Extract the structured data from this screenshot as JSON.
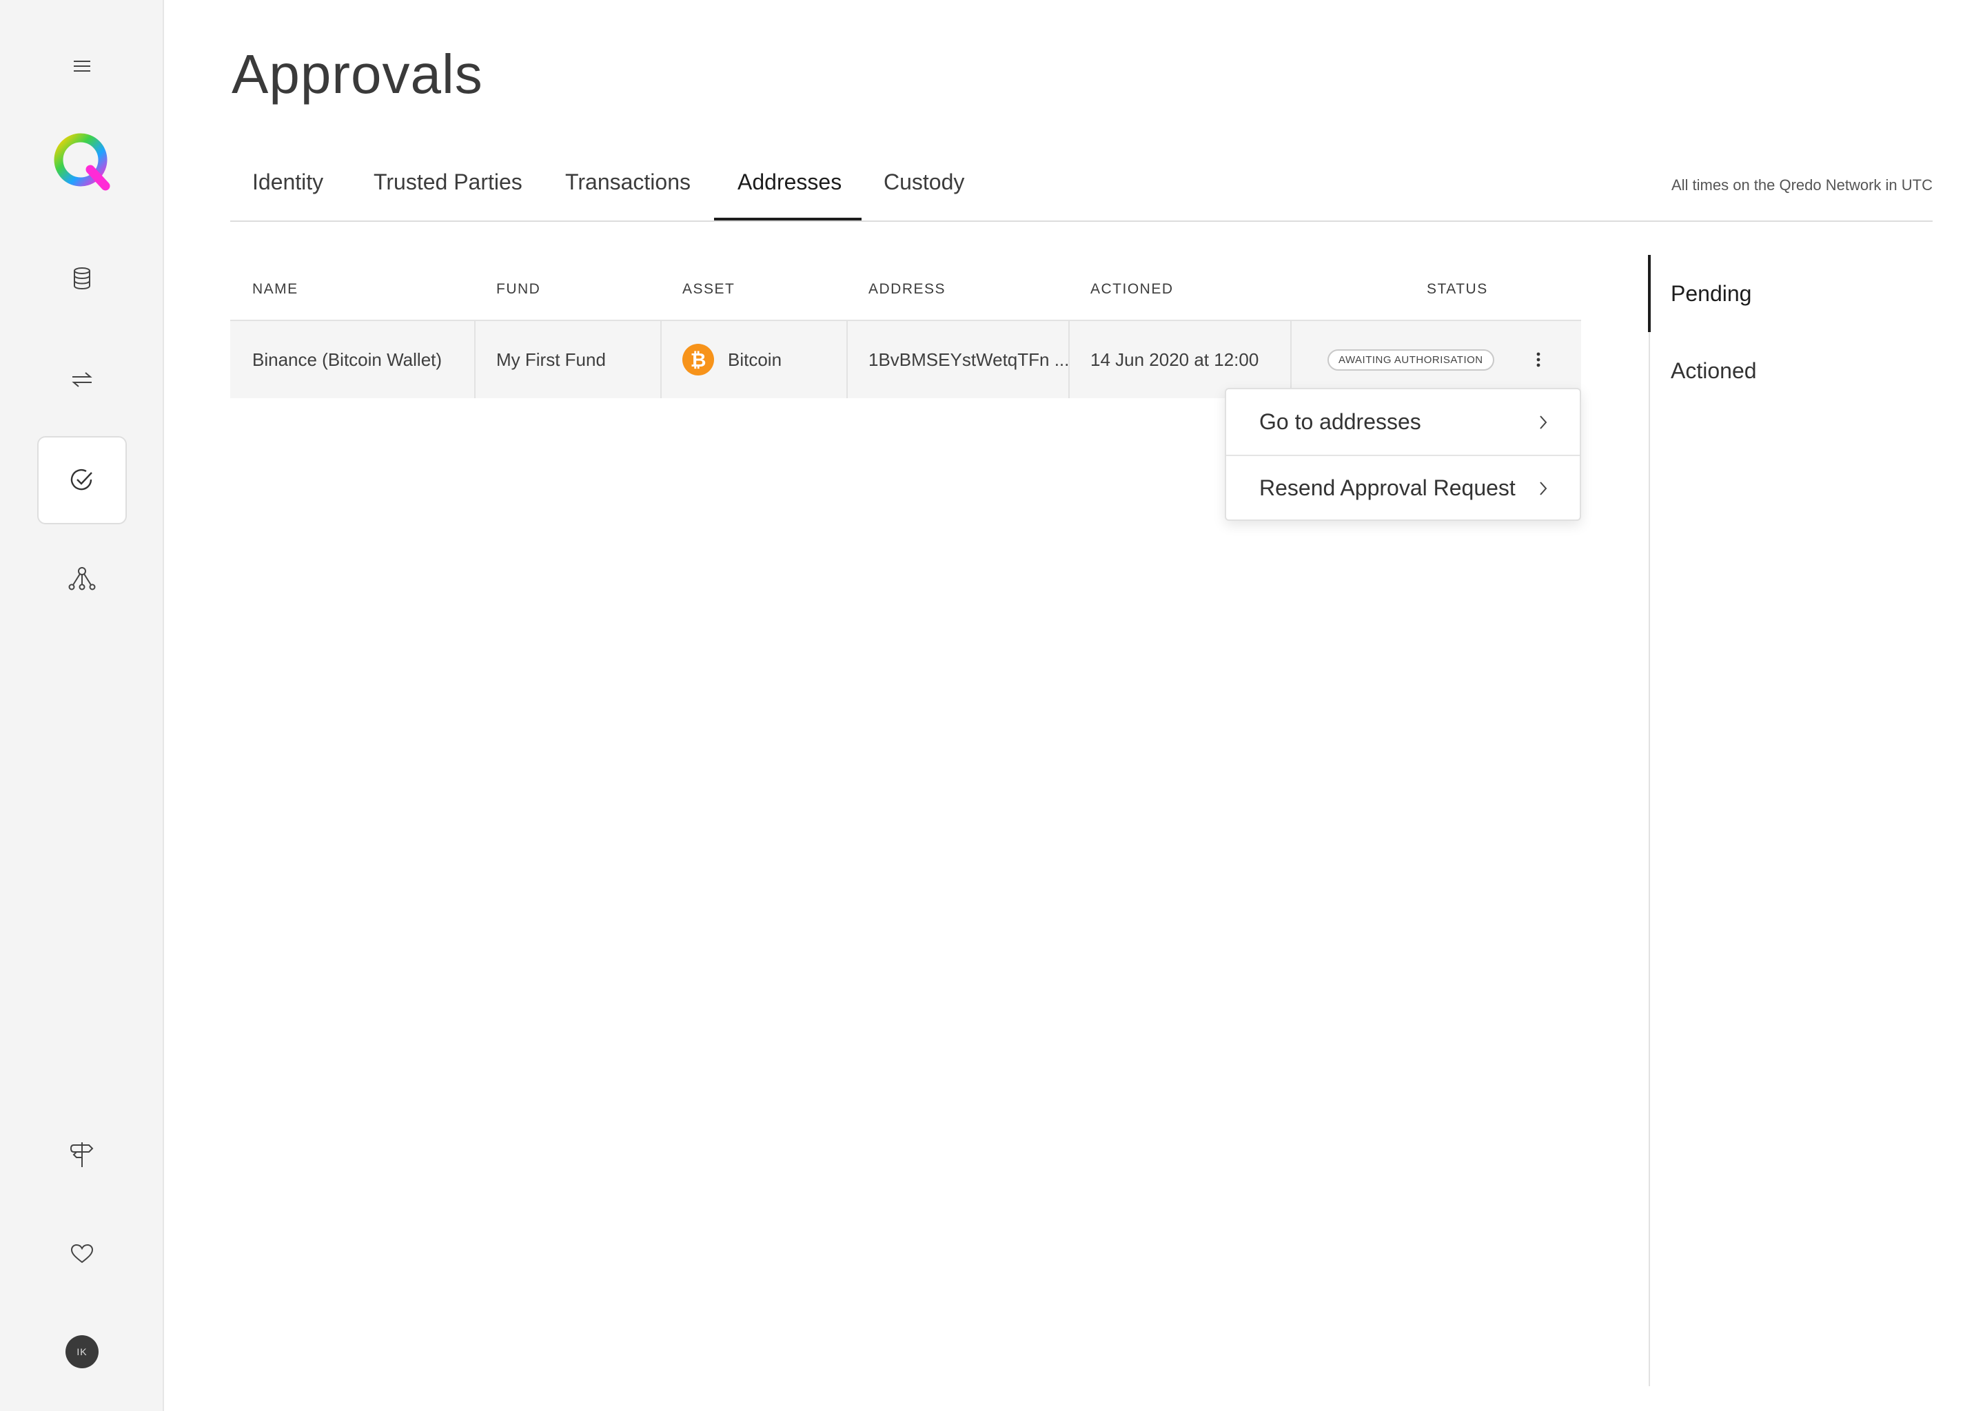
{
  "page": {
    "title": "Approvals"
  },
  "tabs": [
    {
      "label": "Identity"
    },
    {
      "label": "Trusted Parties"
    },
    {
      "label": "Transactions"
    },
    {
      "label": "Addresses",
      "active": true
    },
    {
      "label": "Custody"
    }
  ],
  "utc_note": "All times on the Qredo Network in UTC",
  "table": {
    "headers": [
      "NAME",
      "FUND",
      "ASSET",
      "ADDRESS",
      "ACTIONED",
      "STATUS"
    ],
    "rows": [
      {
        "name": "Binance (Bitcoin Wallet)",
        "fund": "My First Fund",
        "asset": "Bitcoin",
        "asset_icon": "bitcoin-icon",
        "asset_symbol": "₿",
        "address": "1BvBMSEYstWetqTFn ...",
        "actioned": "14 Jun 2020 at 12:00",
        "status": "AWAITING AUTHORISATION"
      }
    ]
  },
  "menu": {
    "items": [
      {
        "label": "Go to addresses"
      },
      {
        "label": "Resend Approval Request"
      }
    ]
  },
  "filters": [
    {
      "label": "Pending",
      "active": true
    },
    {
      "label": "Actioned"
    }
  ],
  "user": {
    "initials": "IK"
  },
  "colors": {
    "bitcoin": "#f7931a",
    "accent": "#1d1d1d",
    "sidebar_bg": "#f4f4f4",
    "row_bg": "#f5f5f5"
  },
  "sidebar_icons": [
    "menu-icon",
    "qredo-logo",
    "database-icon",
    "transfer-icon",
    "approvals-check-icon",
    "network-icon",
    "signpost-icon",
    "heart-icon",
    "user-avatar"
  ]
}
